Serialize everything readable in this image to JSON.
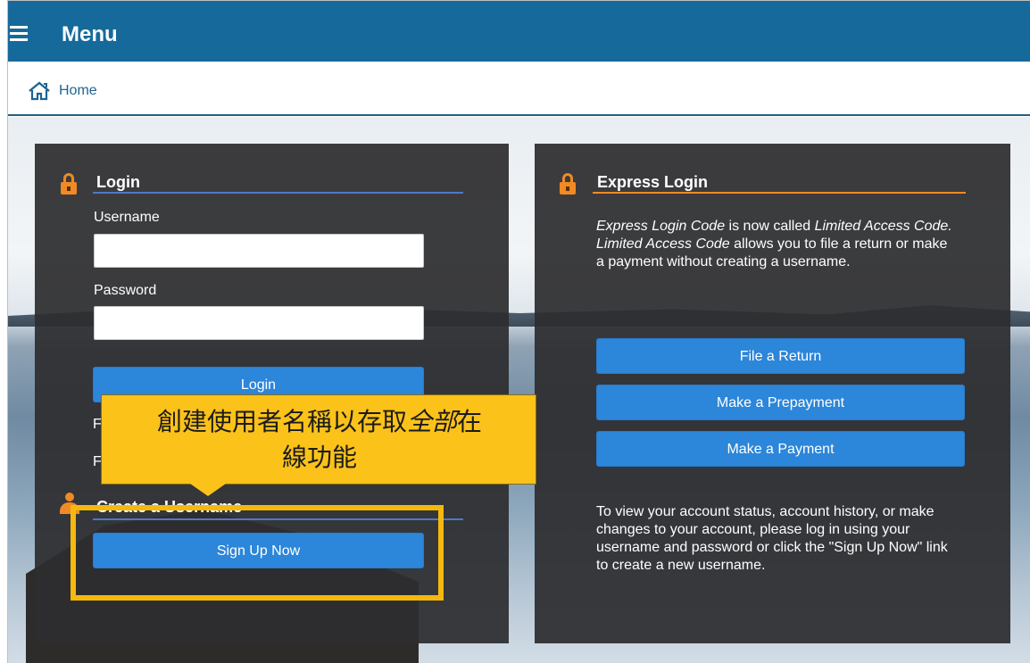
{
  "header": {
    "menu_label": "Menu"
  },
  "breadcrumb": {
    "home_label": "Home"
  },
  "login": {
    "title": "Login",
    "username_label": "Username",
    "username_value": "",
    "password_label": "Password",
    "password_value": "",
    "login_button": "Login",
    "partial_link_1": "F",
    "partial_link_2": "F"
  },
  "create_username": {
    "title": "Create a Username",
    "signup_button": "Sign Up Now"
  },
  "express": {
    "title": "Express Login",
    "desc_italic_1": "Express Login Code",
    "desc_text_1": " is now called ",
    "desc_italic_2": "Limited Access Code. Limited Access Code",
    "desc_text_2": " allows you to file a return or make a payment without creating a username.",
    "buttons": [
      "File a Return",
      "Make a Prepayment",
      "Make a Payment"
    ],
    "footer_text": "To view your account status, account history, or make changes to your account, please log in using your username and password or click the \"Sign Up Now\" link to create a new username."
  },
  "callout": {
    "text_before": "創建使用者名稱以存取",
    "text_italic": "全部",
    "text_after": "在",
    "text_line2": "線功能"
  },
  "colors": {
    "header": "#156a9b",
    "accent_orange": "#f08a24",
    "button_blue": "#2c86d9",
    "callout_yellow": "#fbc21a"
  }
}
